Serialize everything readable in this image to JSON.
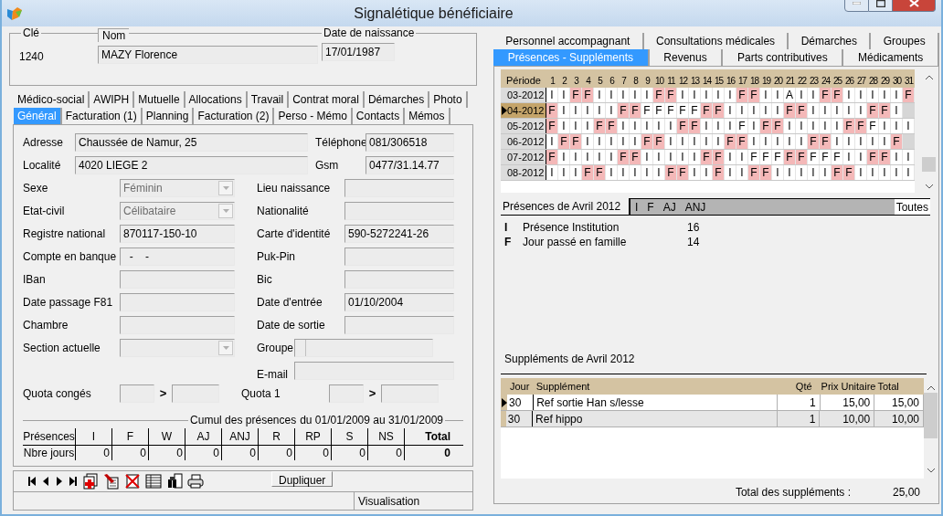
{
  "window": {
    "title": "Signalétique bénéficiaire"
  },
  "identity": {
    "key_label": "Clé",
    "key_value": "1240",
    "name_label": "Nom",
    "name_value": "MAZY Florence",
    "birth_label": "Date de naissance",
    "birth_value": "17/01/1987"
  },
  "left_tabs": [
    [
      {
        "label": "Médico-social",
        "selected": false
      },
      {
        "label": "AWIPH",
        "selected": false
      },
      {
        "label": "Mutuelle",
        "selected": false
      },
      {
        "label": "Allocations",
        "selected": false
      },
      {
        "label": "Travail",
        "selected": false
      },
      {
        "label": "Contrat moral",
        "selected": false
      },
      {
        "label": "Démarches",
        "selected": false
      },
      {
        "label": "Photo",
        "selected": false
      }
    ],
    [
      {
        "label": "Général",
        "selected": true
      },
      {
        "label": "Facturation (1)",
        "selected": false
      },
      {
        "label": "Planning",
        "selected": false
      },
      {
        "label": "Facturation (2)",
        "selected": false
      },
      {
        "label": "Perso - Mémo",
        "selected": false
      },
      {
        "label": "Contacts",
        "selected": false
      },
      {
        "label": "Mémos",
        "selected": false
      }
    ]
  ],
  "form_rows": [
    {
      "kind": "contact",
      "left": {
        "kind": "text",
        "label": "Adresse",
        "value": "Chaussée de Namur, 25"
      },
      "right": {
        "kind": "text",
        "label": "Téléphone",
        "value": "081/306518"
      }
    },
    {
      "kind": "contact",
      "left": {
        "kind": "text",
        "label": "Localité",
        "value": "4020 LIEGE 2"
      },
      "right": {
        "kind": "text",
        "label": "Gsm",
        "value": "0477/31.14.77"
      }
    },
    {
      "kind": "standard",
      "left": {
        "kind": "combo",
        "label": "Sexe",
        "value": "Féminin"
      },
      "right": {
        "kind": "text",
        "label": "Lieu naissance"
      }
    },
    {
      "kind": "standard",
      "left": {
        "kind": "combo",
        "label": "Etat-civil",
        "value": "Célibataire"
      },
      "right": {
        "kind": "text",
        "label": "Nationalité"
      }
    },
    {
      "kind": "standard",
      "left": {
        "kind": "text",
        "label": "Registre national",
        "value": "870117-150-10"
      },
      "right": {
        "kind": "text",
        "label": "Carte d'identité",
        "value": "590-5272241-26"
      }
    },
    {
      "kind": "standard",
      "left": {
        "kind": "text",
        "label": "Compte en banque",
        "value": "  -    -"
      },
      "right": {
        "kind": "text",
        "label": "Puk-Pin"
      }
    },
    {
      "kind": "standard",
      "left": {
        "kind": "text",
        "label": "IBan"
      },
      "right": {
        "kind": "text",
        "label": "Bic"
      }
    },
    {
      "kind": "standard",
      "left": {
        "kind": "text",
        "label": "Date passage F81"
      },
      "right": {
        "kind": "text",
        "label": "Date d'entrée",
        "value": "01/10/2004"
      }
    },
    {
      "kind": "standard",
      "left": {
        "kind": "text",
        "label": "Chambre"
      },
      "right": {
        "kind": "text",
        "label": "Date de sortie"
      }
    },
    {
      "kind": "standard",
      "left": {
        "kind": "combo",
        "label": "Section actuelle"
      },
      "right": {
        "kind": "group",
        "label": "Groupe"
      }
    },
    {
      "kind": "standard",
      "right": {
        "kind": "email",
        "label": "E-mail"
      }
    },
    {
      "kind": "standard",
      "left": {
        "kind": "quota",
        "label": "Quota congés",
        "separator": ">"
      },
      "right": {
        "kind": "quota",
        "label": "Quota 1",
        "separator": ">"
      }
    }
  ],
  "cumul": {
    "title": "Cumul des présences",
    "period": "du 01/01/2009 au 31/01/2009",
    "columns": [
      "Présences",
      "I",
      "F",
      "W",
      "AJ",
      "ANJ",
      "R",
      "RP",
      "S",
      "NS",
      "Total"
    ],
    "row": [
      "Nbre jours",
      "0",
      "0",
      "0",
      "0",
      "0",
      "0",
      "0",
      "0",
      "0",
      "0"
    ]
  },
  "toolbar": {
    "button": "Dupliquer"
  },
  "status_bar": {
    "mode": "Visualisation"
  },
  "right_tabs": [
    [
      {
        "label": "Personnel accompagnant",
        "selected": false
      },
      {
        "label": "Consultations médicales",
        "selected": false
      },
      {
        "label": "Démarches",
        "selected": false
      },
      {
        "label": "Groupes",
        "selected": false
      }
    ],
    [
      {
        "label": "Présences - Suppléments",
        "selected": true
      },
      {
        "label": "Revenus",
        "selected": false
      },
      {
        "label": "Parts contributives",
        "selected": false
      },
      {
        "label": "Médicaments",
        "selected": false
      }
    ]
  ],
  "presences": {
    "period_header": "Période",
    "days": [
      "1",
      "2",
      "3",
      "4",
      "5",
      "6",
      "7",
      "8",
      "9",
      "10",
      "11",
      "12",
      "13",
      "14",
      "15",
      "16",
      "17",
      "18",
      "19",
      "20",
      "21",
      "22",
      "23",
      "24",
      "25",
      "26",
      "27",
      "28",
      "29",
      "30",
      "31"
    ],
    "rows": [
      {
        "period": "03-2012",
        "selected": false,
        "cells": [
          "I",
          "I",
          "F",
          "F",
          "I",
          "I",
          "I",
          "I",
          "I",
          "F",
          "F",
          "I",
          "I",
          "I",
          "I",
          "I",
          "F",
          "F",
          "I",
          "I",
          "A",
          "I",
          "I",
          "F",
          "F",
          "I",
          "I",
          "I",
          "I",
          "I",
          "F"
        ],
        "shaded": [
          false,
          false,
          true,
          true,
          false,
          false,
          false,
          false,
          false,
          true,
          true,
          false,
          false,
          false,
          false,
          false,
          true,
          true,
          false,
          false,
          false,
          false,
          false,
          true,
          true,
          false,
          false,
          false,
          false,
          false,
          true
        ]
      },
      {
        "period": "04-2012",
        "selected": true,
        "cells": [
          "F",
          "I",
          "I",
          "I",
          "I",
          "I",
          "F",
          "F",
          "F",
          "F",
          "F",
          "F",
          "F",
          "F",
          "F",
          "I",
          "I",
          "I",
          "I",
          "I",
          "F",
          "F",
          "I",
          "I",
          "I",
          "I",
          "I",
          "F",
          "F",
          "I"
        ],
        "shaded": [
          true,
          false,
          false,
          false,
          false,
          false,
          true,
          true,
          false,
          false,
          false,
          false,
          false,
          true,
          true,
          false,
          false,
          false,
          false,
          false,
          true,
          true,
          false,
          false,
          false,
          false,
          false,
          true,
          true,
          false
        ]
      },
      {
        "period": "05-2012",
        "selected": false,
        "cells": [
          "F",
          "I",
          "I",
          "I",
          "F",
          "F",
          "I",
          "I",
          "I",
          "I",
          "I",
          "F",
          "F",
          "I",
          "I",
          "I",
          "F",
          "I",
          "F",
          "F",
          "I",
          "I",
          "I",
          "I",
          "I",
          "F",
          "F",
          "F",
          "I",
          "I",
          "I"
        ],
        "shaded": [
          true,
          false,
          false,
          false,
          true,
          true,
          false,
          false,
          false,
          false,
          false,
          true,
          true,
          false,
          false,
          false,
          false,
          false,
          true,
          true,
          false,
          false,
          false,
          false,
          false,
          true,
          true,
          false,
          false,
          false,
          false
        ]
      },
      {
        "period": "06-2012",
        "selected": false,
        "cells": [
          "I",
          "F",
          "F",
          "I",
          "I",
          "I",
          "I",
          "I",
          "F",
          "F",
          "I",
          "I",
          "I",
          "I",
          "I",
          "F",
          "F",
          "I",
          "I",
          "I",
          "I",
          "I",
          "F",
          "F",
          "I",
          "I",
          "I",
          "I",
          "I",
          "F"
        ],
        "shaded": [
          false,
          true,
          true,
          false,
          false,
          false,
          false,
          false,
          true,
          true,
          false,
          false,
          false,
          false,
          false,
          true,
          true,
          false,
          false,
          false,
          false,
          false,
          true,
          true,
          false,
          false,
          false,
          false,
          false,
          true
        ]
      },
      {
        "period": "07-2012",
        "selected": false,
        "cells": [
          "F",
          "I",
          "I",
          "I",
          "I",
          "I",
          "F",
          "F",
          "I",
          "I",
          "I",
          "I",
          "I",
          "F",
          "F",
          "I",
          "I",
          "F",
          "F",
          "F",
          "F",
          "F",
          "F",
          "F",
          "F",
          "I",
          "I",
          "F",
          "F",
          "I",
          "I"
        ],
        "shaded": [
          true,
          false,
          false,
          false,
          false,
          false,
          true,
          true,
          false,
          false,
          false,
          false,
          false,
          true,
          true,
          false,
          false,
          false,
          false,
          false,
          true,
          true,
          false,
          false,
          false,
          false,
          false,
          true,
          true,
          false,
          false
        ]
      },
      {
        "period": "08-2012",
        "selected": false,
        "cells": [
          "I",
          "I",
          "I",
          "F",
          "F",
          "I",
          "I",
          "I",
          "I",
          "I",
          "F",
          "F",
          "I",
          "I",
          "F",
          "I",
          "I",
          "F",
          "F",
          "I",
          "I",
          "I",
          "I",
          "I",
          "F",
          "F",
          "I",
          "I",
          "I",
          "I",
          "I"
        ],
        "shaded": [
          false,
          false,
          false,
          true,
          true,
          false,
          false,
          false,
          false,
          false,
          true,
          true,
          false,
          false,
          true,
          false,
          false,
          true,
          true,
          false,
          false,
          false,
          false,
          false,
          true,
          true,
          false,
          false,
          false,
          false,
          false
        ]
      }
    ]
  },
  "month_summary": {
    "title": "Présences de Avril 2012",
    "filters": [
      "I",
      "F",
      "AJ",
      "ANJ"
    ],
    "all_button": "Toutes",
    "legend": [
      {
        "code": "I",
        "label": "Présence Institution",
        "count": "16"
      },
      {
        "code": "F",
        "label": "Jour passé en famille",
        "count": "14"
      }
    ]
  },
  "supplements": {
    "title": "Suppléments de Avril 2012",
    "columns": [
      "Jour",
      "Supplément",
      "Qté",
      "Prix Unitaire",
      "Total"
    ],
    "rows": [
      {
        "selected": true,
        "cells": [
          "30",
          "Ref sortie Han s/lesse",
          "1",
          "15,00",
          "15,00"
        ]
      },
      {
        "selected": false,
        "cells": [
          "30",
          "Ref hippo",
          "1",
          "10,00",
          "10,00"
        ]
      }
    ],
    "total_label": "Total des suppléments :",
    "total_value": "25,00"
  }
}
